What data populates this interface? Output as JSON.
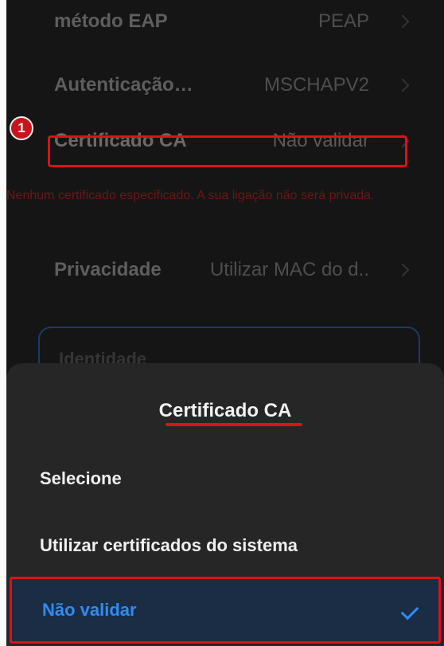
{
  "settings": {
    "rows": [
      {
        "label": "método EAP",
        "value": "PEAP"
      },
      {
        "label": "Autenticação…",
        "value": "MSCHAPV2"
      },
      {
        "label": "Certificado CA",
        "value": "Não validar"
      },
      {
        "label": "Privacidade",
        "value": "Utilizar MAC do d.."
      }
    ],
    "warning": "Nenhum certificado especificado. A sua ligação não será privada.",
    "identity_label": "Identidade"
  },
  "annotation": {
    "step_number": "1",
    "highlight_color": "#e10f19"
  },
  "sheet": {
    "title": "Certificado CA",
    "options": [
      {
        "label": "Selecione",
        "selected": false
      },
      {
        "label": "Utilizar certificados do sistema",
        "selected": false
      },
      {
        "label": "Não validar",
        "selected": true
      }
    ],
    "accent_color": "#2f8cf0",
    "check_icon": "check-icon"
  }
}
